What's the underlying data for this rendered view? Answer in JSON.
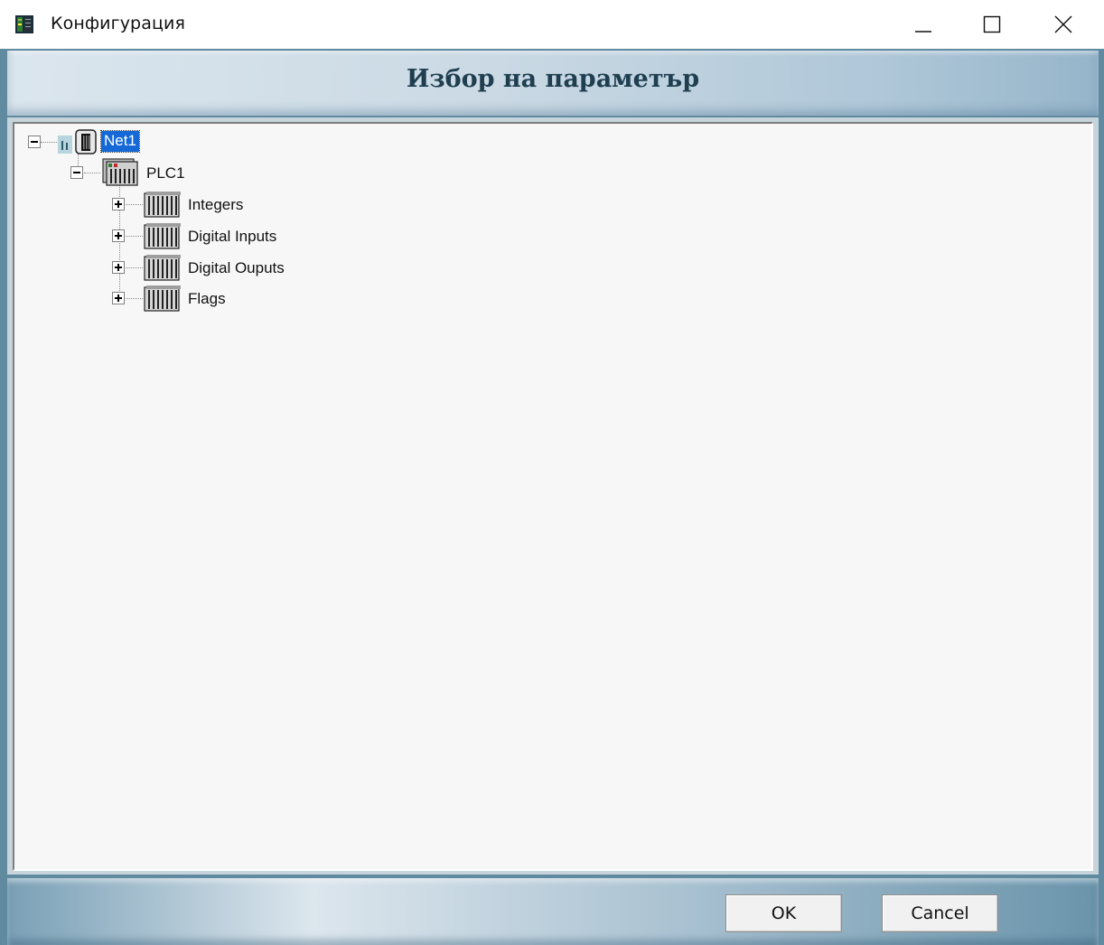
{
  "window": {
    "title": "Конфигурация",
    "app_icon": "app-icon",
    "controls": [
      "minimize-icon",
      "maximize-icon",
      "close-icon"
    ]
  },
  "header": {
    "title": "Избор на параметър"
  },
  "tree": {
    "root": {
      "label": "Net1",
      "icon": "network-icon",
      "expanded": true,
      "selected": true,
      "children": [
        {
          "label": "PLC1",
          "icon": "plc-icon",
          "expanded": true,
          "children": [
            {
              "label": "Integers",
              "icon": "module-icon",
              "expanded": false
            },
            {
              "label": "Digital Inputs",
              "icon": "module-icon",
              "expanded": false
            },
            {
              "label": "Digital Ouputs",
              "icon": "module-icon",
              "expanded": false
            },
            {
              "label": "Flags",
              "icon": "module-icon",
              "expanded": false
            }
          ]
        }
      ]
    }
  },
  "buttons": {
    "ok": "OK",
    "cancel": "Cancel"
  },
  "colors": {
    "frame": "#5f8aa0",
    "selection": "#1569d7",
    "header_text": "#1f3f50"
  }
}
